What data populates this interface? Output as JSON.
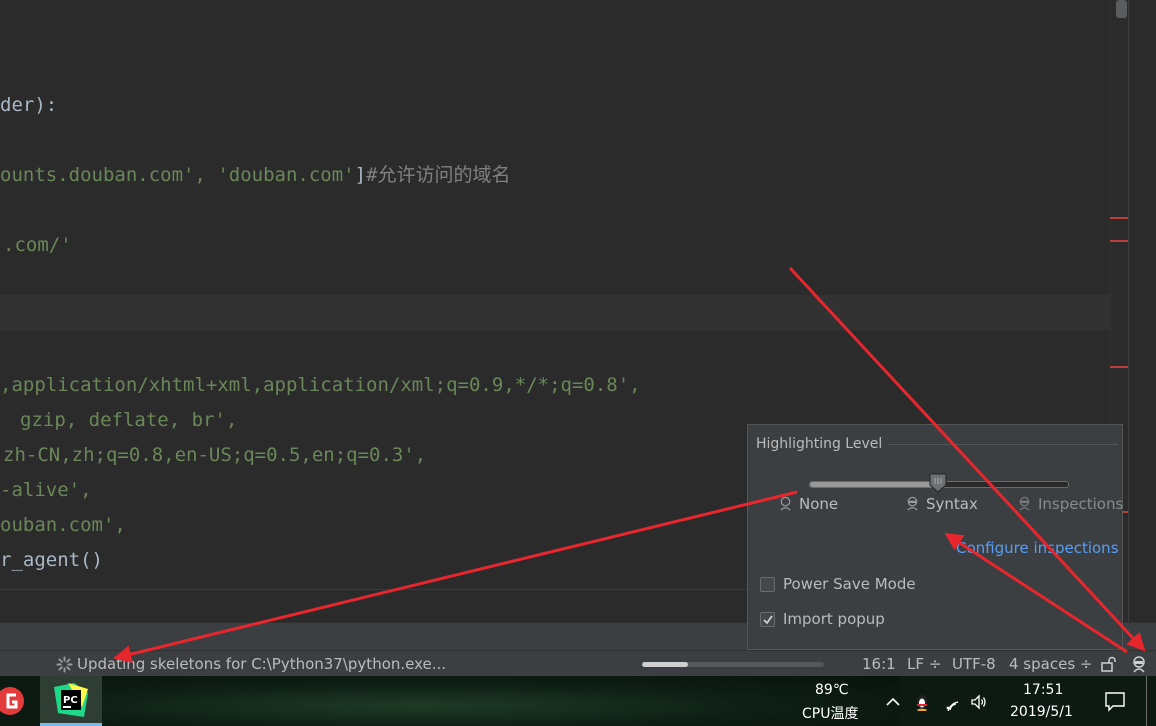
{
  "editor": {
    "lines": [
      {
        "parts": [
          {
            "t": "der):",
            "c": "plain"
          }
        ]
      },
      {
        "parts": [
          {
            "t": "ounts.douban.com', 'douban.com'",
            "c": "str"
          },
          {
            "t": "]",
            "c": "plain"
          },
          {
            "t": "#允许访问的域名",
            "c": "cmt"
          }
        ]
      },
      {
        "parts": [
          {
            "t": ".com/'",
            "c": "str"
          }
        ]
      },
      {
        "parts": [
          {
            "t": ",application/xhtml+xml,application/xml;q=0.9,*/*;q=0.8',",
            "c": "str"
          }
        ]
      },
      {
        "parts": [
          {
            "t": "gzip, deflate, br',",
            "c": "str"
          }
        ]
      },
      {
        "parts": [
          {
            "t": "zh-CN,zh;q=0.8,en-US;q=0.5,en;q=0.3',",
            "c": "str"
          }
        ]
      },
      {
        "parts": [
          {
            "t": "-alive',",
            "c": "str"
          }
        ]
      },
      {
        "parts": [
          {
            "t": "ouban.com',",
            "c": "str"
          }
        ]
      },
      {
        "parts": [
          {
            "t": "r_agent()",
            "c": "plain"
          }
        ]
      }
    ]
  },
  "popup": {
    "title": "Highlighting Level",
    "levels": [
      "None",
      "Syntax",
      "Inspections"
    ],
    "selected_level": "Syntax",
    "slider_fraction": 0.5,
    "configure_link": "Configure inspections",
    "power_save_label": "Power Save Mode",
    "power_save_checked": false,
    "import_popup_label": "Import popup",
    "import_popup_checked": true
  },
  "statusbar": {
    "task": "Updating skeletons for C:\\Python37\\python.exe...",
    "progress_fraction": 0.25,
    "position": "16:1",
    "line_ending": "LF ÷",
    "encoding": "UTF-8",
    "indent": "4 spaces ÷"
  },
  "taskbar": {
    "cpu_temp": "89℃",
    "cpu_label": "CPU温度",
    "time": "17:51",
    "date": "2019/5/1"
  },
  "colors": {
    "editor_bg": "#2b2b2b",
    "string": "#6a8759",
    "comment": "#808080",
    "link": "#589df6",
    "annotation": "#e8262d"
  }
}
